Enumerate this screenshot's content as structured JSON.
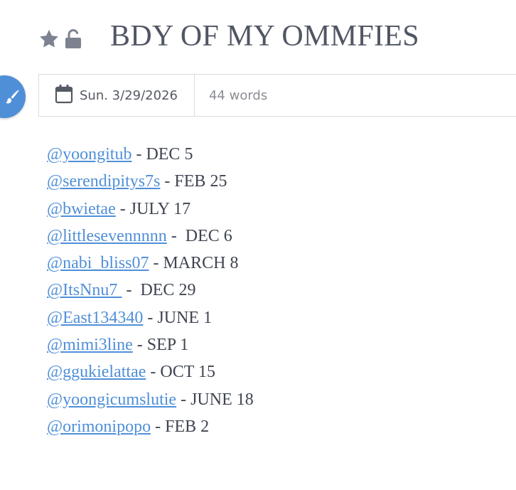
{
  "header": {
    "title": "BDY OF MY OMMFIES",
    "star_icon": "star-icon",
    "lock_icon": "unlocked-lock-icon"
  },
  "accent_color": "#4f8fd8",
  "meta": {
    "date": "Sun. 3/29/2026",
    "word_count": "44 words"
  },
  "entries": [
    {
      "handle": "@yoongitub",
      "separator": " - ",
      "date": "DEC 5"
    },
    {
      "handle": "@serendipitys7s",
      "separator": " - ",
      "date": "FEB 25"
    },
    {
      "handle": "@bwietae",
      "separator": " - ",
      "date": "JULY 17"
    },
    {
      "handle": "@littlesevennnnn",
      "separator": " -  ",
      "date": "DEC 6"
    },
    {
      "handle": "@nabi_bliss07",
      "separator": " - ",
      "date": "MARCH 8"
    },
    {
      "handle": "@ItsNnu7 ",
      "separator": " -  ",
      "date": "DEC 29"
    },
    {
      "handle": "@East134340",
      "separator": " - ",
      "date": "JUNE 1"
    },
    {
      "handle": "@mimi3line",
      "separator": " - ",
      "date": "SEP 1"
    },
    {
      "handle": "@ggukielattae",
      "separator": " - ",
      "date": "OCT 15"
    },
    {
      "handle": "@yoongicumslutie",
      "separator": " - ",
      "date": "JUNE 18"
    },
    {
      "handle": "@orimonipopo",
      "separator": " - ",
      "date": "FEB 2"
    }
  ]
}
